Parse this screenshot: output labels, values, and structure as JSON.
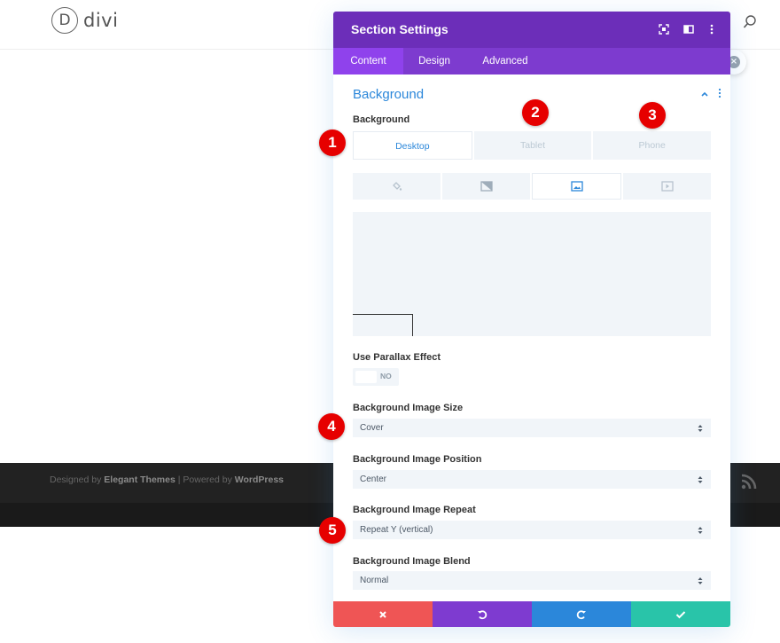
{
  "site": {
    "logo_letter": "D",
    "logo_text": "divi",
    "footer_prefix": "Designed by ",
    "footer_brand": "Elegant Themes",
    "footer_mid": " | Powered by ",
    "footer_cms": "WordPress"
  },
  "modal": {
    "title": "Section Settings",
    "tabs": [
      "Content",
      "Design",
      "Advanced"
    ],
    "section_title": "Background",
    "background_label": "Background",
    "devices": [
      "Desktop",
      "Tablet",
      "Phone"
    ],
    "parallax_label": "Use Parallax Effect",
    "parallax_value": "NO",
    "fields": [
      {
        "label": "Background Image Size",
        "value": "Cover"
      },
      {
        "label": "Background Image Position",
        "value": "Center"
      },
      {
        "label": "Background Image Repeat",
        "value": "Repeat Y (vertical)"
      },
      {
        "label": "Background Image Blend",
        "value": "Normal"
      }
    ]
  },
  "markers": [
    "1",
    "2",
    "3",
    "4",
    "5"
  ],
  "colors": {
    "header": "#6c2eb9",
    "tabs": "#7d3bcf",
    "accent": "#2b87da",
    "cancel": "#ef5555",
    "undo": "#7e3bd0",
    "redo": "#2b87da",
    "save": "#29c4a9",
    "marker": "#e60000"
  }
}
